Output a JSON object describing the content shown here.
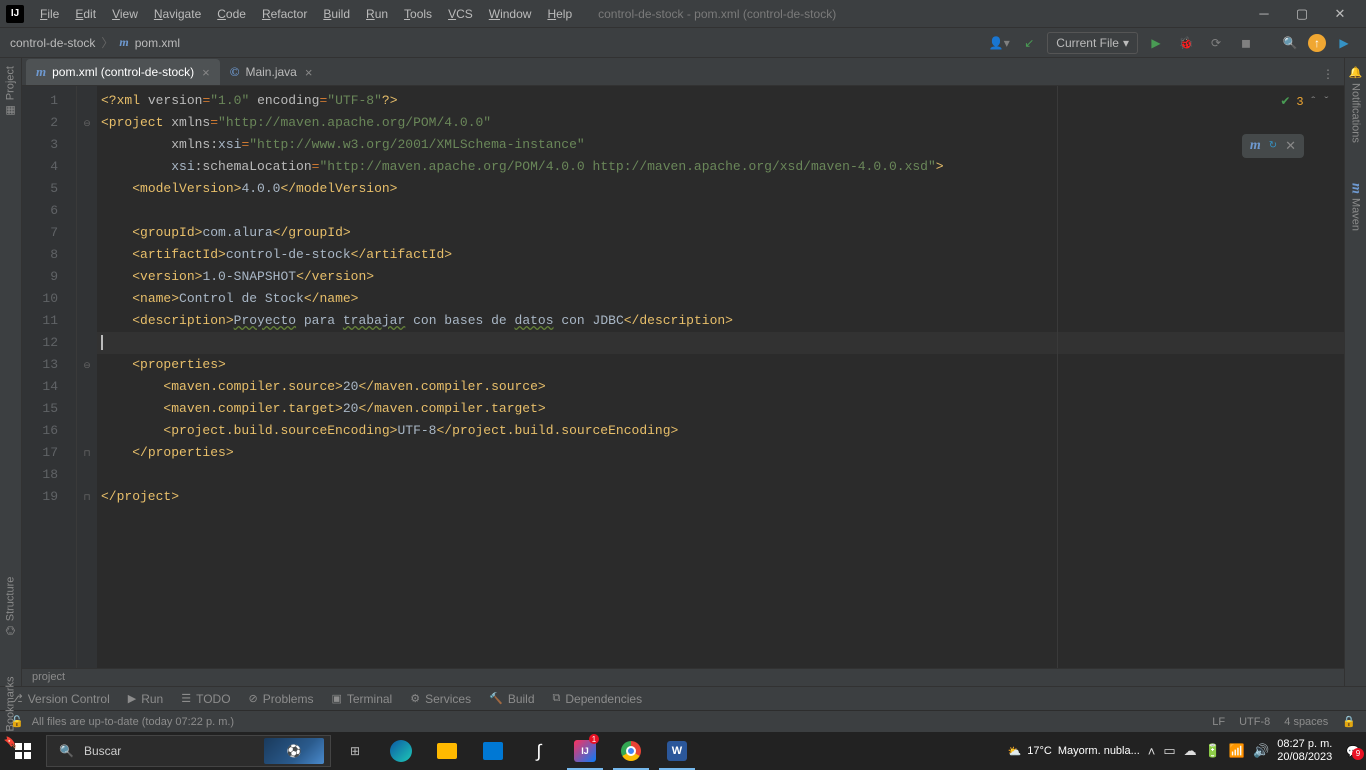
{
  "menubar": [
    "File",
    "Edit",
    "View",
    "Navigate",
    "Code",
    "Refactor",
    "Build",
    "Run",
    "Tools",
    "VCS",
    "Window",
    "Help"
  ],
  "window_title": "control-de-stock - pom.xml (control-de-stock)",
  "breadcrumb": {
    "project": "control-de-stock",
    "file": "pom.xml"
  },
  "run_config": "Current File",
  "tabs": [
    {
      "icon": "m",
      "label": "pom.xml (control-de-stock)",
      "active": true
    },
    {
      "icon": "©",
      "label": "Main.java",
      "active": false
    }
  ],
  "left_strip": {
    "project": "Project",
    "structure": "Structure",
    "bookmarks": "Bookmarks"
  },
  "right_strip": {
    "notifications": "Notifications",
    "maven": "Maven"
  },
  "inspection": {
    "count": "3"
  },
  "editor": {
    "lines": [
      {
        "n": 1,
        "html": "<span class='tag'>&lt;?xml</span><span class='attr'> version</span><span class='op'>=</span><span class='val'>\"1.0\"</span><span class='attr'> encoding</span><span class='op'>=</span><span class='val'>\"UTF-8\"</span><span class='tag'>?&gt;</span>"
      },
      {
        "n": 2,
        "html": "<span class='tag'>&lt;project</span><span class='attr'> xmlns</span><span class='op'>=</span><span class='val'>\"http://maven.apache.org/POM/4.0.0\"</span>",
        "fold": "⊖"
      },
      {
        "n": 3,
        "html": "         <span class='attr'>xmlns:</span><span class='txt'>xsi</span><span class='op'>=</span><span class='val'>\"http://www.w3.org/2001/XMLSchema-instance\"</span>"
      },
      {
        "n": 4,
        "html": "         <span class='txt'>xsi</span><span class='attr'>:schemaLocation</span><span class='op'>=</span><span class='val'>\"http://maven.apache.org/POM/4.0.0 http://maven.apache.org/xsd/maven-4.0.0.xsd\"</span><span class='tag'>&gt;</span>"
      },
      {
        "n": 5,
        "html": "    <span class='tag'>&lt;modelVersion&gt;</span><span class='txt'>4.0.0</span><span class='tag'>&lt;/modelVersion&gt;</span>"
      },
      {
        "n": 6,
        "html": ""
      },
      {
        "n": 7,
        "html": "    <span class='tag'>&lt;groupId&gt;</span><span class='txt'>com.alura</span><span class='tag'>&lt;/groupId&gt;</span>"
      },
      {
        "n": 8,
        "html": "    <span class='tag'>&lt;artifactId&gt;</span><span class='txt'>control-de-stock</span><span class='tag'>&lt;/artifactId&gt;</span>"
      },
      {
        "n": 9,
        "html": "    <span class='tag'>&lt;version&gt;</span><span class='txt'>1.0-SNAPSHOT</span><span class='tag'>&lt;/version&gt;</span>"
      },
      {
        "n": 10,
        "html": "    <span class='tag'>&lt;name&gt;</span><span class='txt'>Control de Stock</span><span class='tag'>&lt;/name&gt;</span>"
      },
      {
        "n": 11,
        "html": "    <span class='tag'>&lt;description&gt;</span><span class='txt typo'>Proyecto</span><span class='txt'> para </span><span class='txt typo'>trabajar</span><span class='txt'> con bases de </span><span class='txt typo'>datos</span><span class='txt'> con JDBC</span><span class='tag'>&lt;/description&gt;</span>"
      },
      {
        "n": 12,
        "html": "<span class='cursor-caret'></span>",
        "current": true
      },
      {
        "n": 13,
        "html": "    <span class='tag'>&lt;properties&gt;</span>",
        "fold": "⊖"
      },
      {
        "n": 14,
        "html": "        <span class='tag'>&lt;maven.compiler.source&gt;</span><span class='txt'>20</span><span class='tag'>&lt;/maven.compiler.source&gt;</span>"
      },
      {
        "n": 15,
        "html": "        <span class='tag'>&lt;maven.compiler.target&gt;</span><span class='txt'>20</span><span class='tag'>&lt;/maven.compiler.target&gt;</span>"
      },
      {
        "n": 16,
        "html": "        <span class='tag'>&lt;project.build.sourceEncoding&gt;</span><span class='txt'>UTF-8</span><span class='tag'>&lt;/project.build.sourceEncoding&gt;</span>"
      },
      {
        "n": 17,
        "html": "    <span class='tag'>&lt;/properties&gt;</span>",
        "fold": "⊓"
      },
      {
        "n": 18,
        "html": ""
      },
      {
        "n": 19,
        "html": "<span class='tag'>&lt;/project&gt;</span>",
        "fold": "⊓"
      }
    ]
  },
  "project_footer": "project",
  "toolwindows": [
    {
      "icon": "⎇",
      "label": "Version Control"
    },
    {
      "icon": "▶",
      "label": "Run"
    },
    {
      "icon": "☰",
      "label": "TODO"
    },
    {
      "icon": "⊘",
      "label": "Problems"
    },
    {
      "icon": "▣",
      "label": "Terminal"
    },
    {
      "icon": "⚙",
      "label": "Services"
    },
    {
      "icon": "🔨",
      "label": "Build"
    },
    {
      "icon": "⧉",
      "label": "Dependencies"
    }
  ],
  "statusbar": {
    "left": "All files are up-to-date (today 07:22 p. m.)",
    "right": [
      "LF",
      "UTF-8",
      "4 spaces"
    ]
  },
  "taskbar": {
    "search_placeholder": "Buscar",
    "weather": {
      "temp": "17°C",
      "cond": "Mayorm. nubla..."
    },
    "clock": {
      "time": "08:27 p. m.",
      "date": "20/08/2023"
    },
    "notif_badge": "9"
  }
}
